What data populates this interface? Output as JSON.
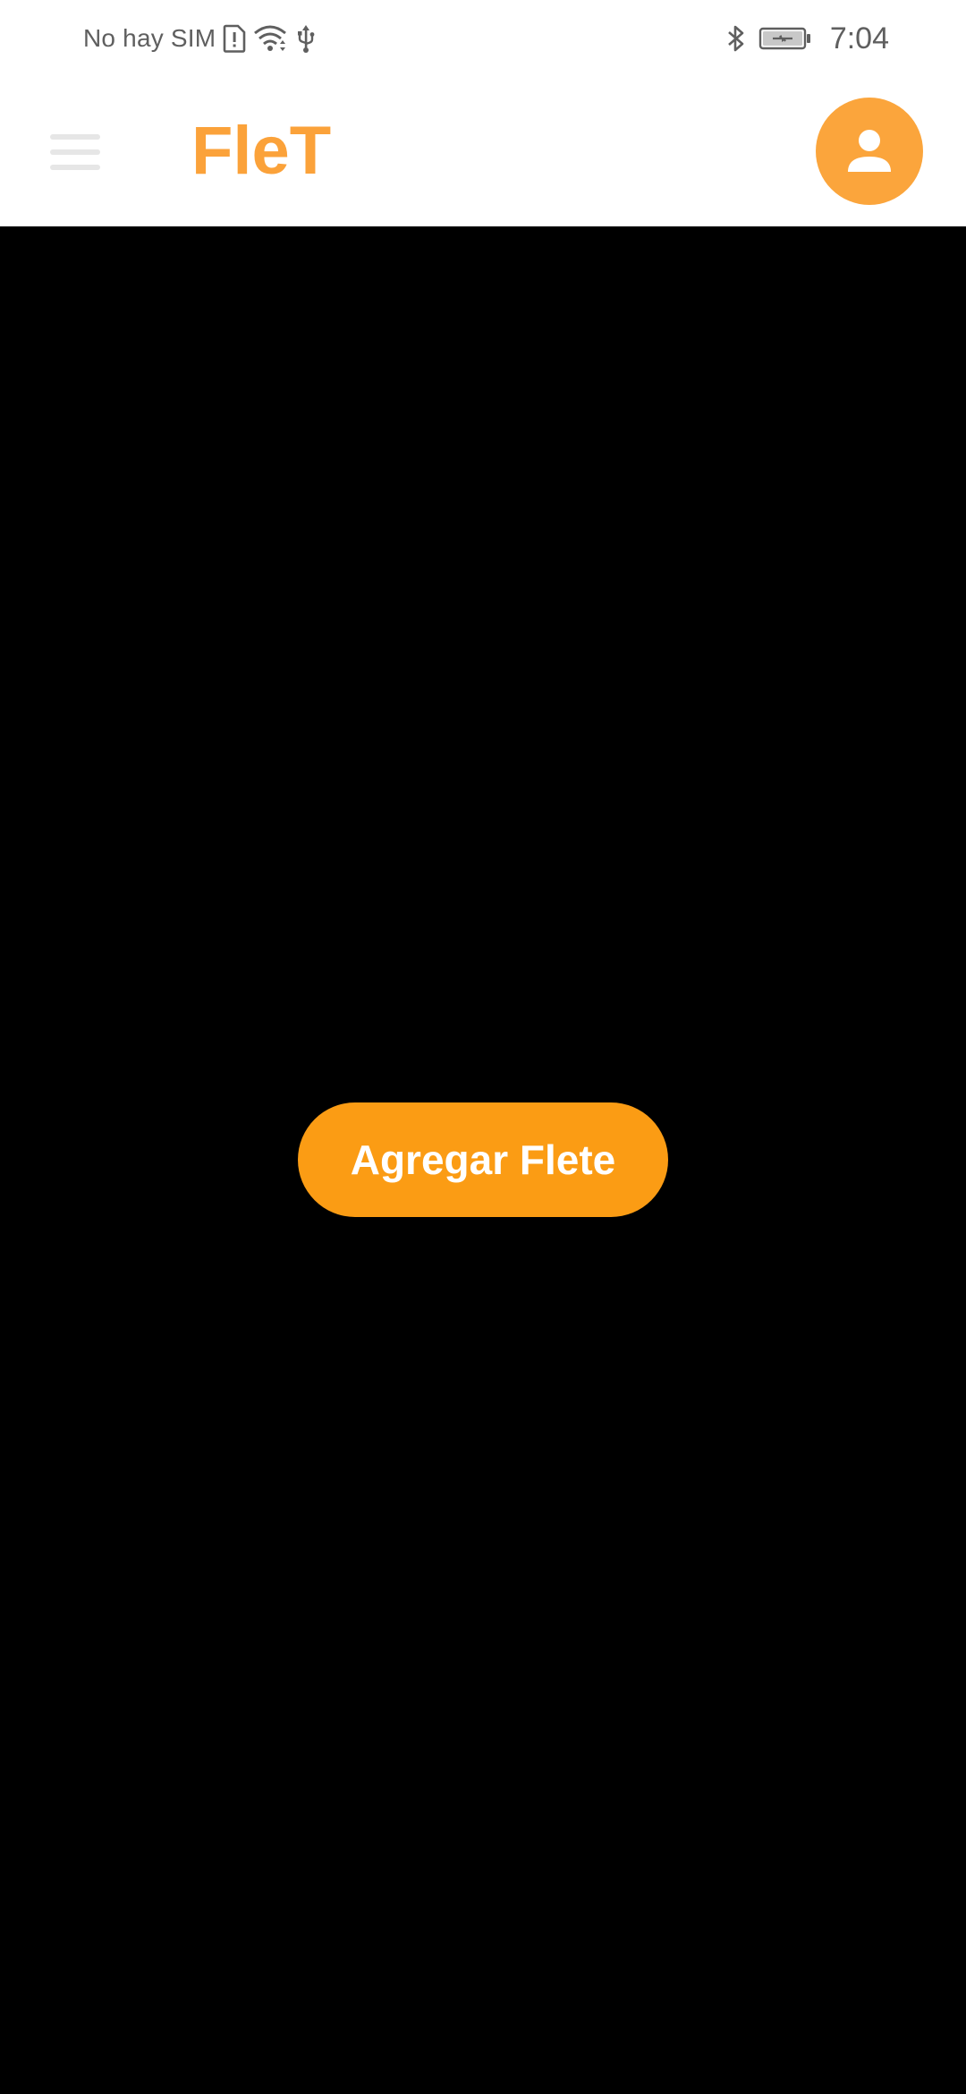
{
  "status_bar": {
    "carrier_text": "No hay SIM",
    "time": "7:04",
    "icons": [
      "sim-alert-icon",
      "wifi-icon",
      "usb-icon",
      "bluetooth-icon",
      "battery-charging-icon"
    ]
  },
  "app_bar": {
    "title": "FleT",
    "menu_icon": "hamburger-menu-icon",
    "profile_icon": "person-icon"
  },
  "main": {
    "add_button_label": "Agregar Flete"
  },
  "colors": {
    "brand": "#fba23a",
    "button": "#fb9c14",
    "avatar": "#fba53c",
    "background": "#000000",
    "bar_background": "#ffffff",
    "status_icons": "#5f5f5f"
  }
}
